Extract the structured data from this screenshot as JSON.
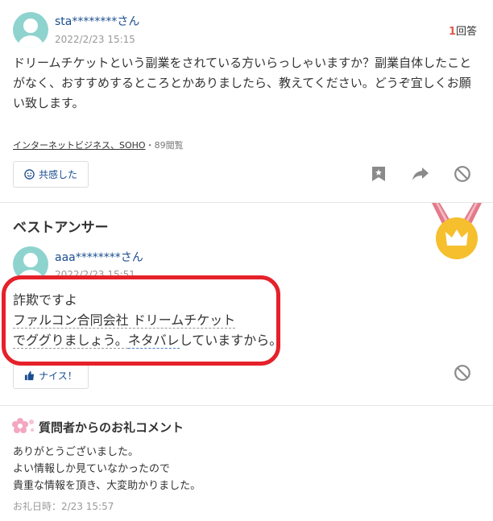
{
  "question": {
    "user": "sta********さん",
    "date": "2022/2/23 15:15",
    "answer_count": "1",
    "answer_count_suffix": "回答",
    "text": "ドリームチケットという副業をされている方いらっしゃいますか？副業自体したことがなく、おすすめするところとかありましたら、教えてください。どうぞ宜しくお願い致します。",
    "category": "インターネットビジネス、SOHO",
    "views": "・89閲覧",
    "empathy_button": "共感した"
  },
  "best_answer": {
    "heading": "ベストアンサー",
    "user": "aaa********さん",
    "date": "2022/2/23 15:51",
    "line1": "詐欺ですよ",
    "line2_link": "ファルコン合同会社 ドリームチケット",
    "line3_pre": "でググりましょう。",
    "line3_link": "ネタバレ",
    "line3_post": "していますから。",
    "naisu_button": "ナイス！"
  },
  "thanks": {
    "heading": "質問者からのお礼コメント",
    "lines": [
      "ありがとうございました。",
      "よい情報しか見ていなかったので",
      "貴重な情報を頂き、大変助かりました。"
    ],
    "time": "お礼日時：2/23 15:57"
  },
  "colors": {
    "highlight": "#e5212a",
    "link": "#1a4d8f",
    "medal": "#f5bf2e",
    "answer_count": "#e05a4f"
  }
}
